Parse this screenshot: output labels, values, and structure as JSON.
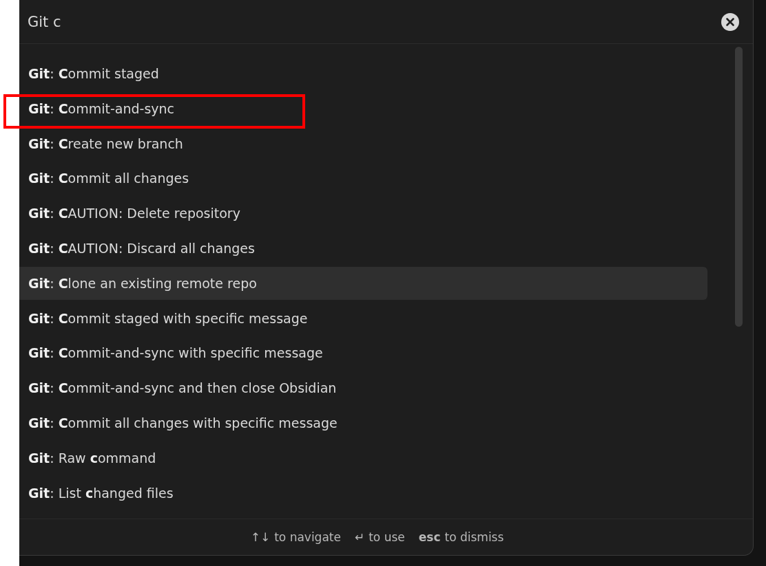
{
  "search": {
    "value": "Git c"
  },
  "results": [
    {
      "label": "**Git**: **C**ommit staged",
      "selected": false,
      "annotated": false
    },
    {
      "label": "**Git**: **C**ommit-and-sync",
      "selected": false,
      "annotated": true
    },
    {
      "label": "**Git**: **C**reate new branch",
      "selected": false,
      "annotated": false
    },
    {
      "label": "**Git**: **C**ommit all changes",
      "selected": false,
      "annotated": false
    },
    {
      "label": "**Git**: **C**AUTION: Delete repository",
      "selected": false,
      "annotated": false
    },
    {
      "label": "**Git**: **C**AUTION: Discard all changes",
      "selected": false,
      "annotated": false
    },
    {
      "label": "**Git**: **C**lone an existing remote repo",
      "selected": true,
      "annotated": false
    },
    {
      "label": "**Git**: **C**ommit staged with specific message",
      "selected": false,
      "annotated": false
    },
    {
      "label": "**Git**: **C**ommit-and-sync with specific message",
      "selected": false,
      "annotated": false
    },
    {
      "label": "**Git**: **C**ommit-and-sync and then close Obsidian",
      "selected": false,
      "annotated": false
    },
    {
      "label": "**Git**: **C**ommit all changes with specific message",
      "selected": false,
      "annotated": false
    },
    {
      "label": "**Git**: Raw **c**ommand",
      "selected": false,
      "annotated": false
    },
    {
      "label": "**Git**: List **c**hanged files",
      "selected": false,
      "annotated": false
    }
  ],
  "hints": [
    {
      "key": "↑↓",
      "text": "to navigate"
    },
    {
      "key": "↵",
      "text": "to use"
    },
    {
      "key": "esc",
      "text": "to dismiss"
    }
  ]
}
